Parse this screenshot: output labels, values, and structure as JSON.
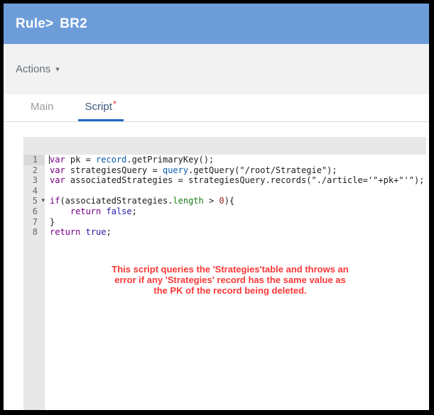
{
  "header": {
    "breadcrumb": "Rule>",
    "title": "BR2"
  },
  "actions": {
    "label": "Actions",
    "caret_icon": "caret-down",
    "caret_glyph": "▾"
  },
  "tabs": [
    {
      "label": "Main",
      "active": false
    },
    {
      "label": "Script",
      "dirty": "*",
      "active": true
    }
  ],
  "editor": {
    "lines": [
      {
        "no": "1",
        "active": true,
        "cursor": true,
        "tokens": [
          [
            "kw",
            "var"
          ],
          [
            "pl",
            " pk = "
          ],
          [
            "obj",
            "record"
          ],
          [
            "pl",
            ".getPrimaryKey();"
          ]
        ]
      },
      {
        "no": "2",
        "tokens": [
          [
            "kw",
            "var"
          ],
          [
            "pl",
            " strategiesQuery = "
          ],
          [
            "obj",
            "query"
          ],
          [
            "pl",
            ".getQuery(\"/root/Strategie\");"
          ]
        ]
      },
      {
        "no": "3",
        "tokens": [
          [
            "kw",
            "var"
          ],
          [
            "pl",
            " associatedStrategies = strategiesQuery.records(\"./article='\"+pk+\"'\");"
          ]
        ]
      },
      {
        "no": "4",
        "tokens": []
      },
      {
        "no": "5",
        "fold": "▾",
        "tokens": [
          [
            "kw",
            "if"
          ],
          [
            "pl",
            "(associatedStrategies."
          ],
          [
            "prop",
            "length"
          ],
          [
            "pl",
            " > "
          ],
          [
            "num",
            "0"
          ],
          [
            "pl",
            "){"
          ]
        ]
      },
      {
        "no": "6",
        "tokens": [
          [
            "pl",
            "    "
          ],
          [
            "kw",
            "return"
          ],
          [
            "pl",
            " "
          ],
          [
            "atom",
            "false"
          ],
          [
            "pl",
            ";"
          ]
        ]
      },
      {
        "no": "7",
        "tokens": [
          [
            "pl",
            "}"
          ]
        ]
      },
      {
        "no": "8",
        "tokens": [
          [
            "kw",
            "return"
          ],
          [
            "pl",
            " "
          ],
          [
            "atom",
            "true"
          ],
          [
            "pl",
            ";"
          ]
        ]
      }
    ],
    "annotation_lines": [
      "This script queries the 'Strategies'table and throws an",
      "error if any 'Strategies' record has the same value as",
      "the PK of the record being deleted."
    ]
  },
  "palette": {
    "header_blue": "#6d9dd9",
    "tab_underline_blue": "#2269c3",
    "keyword": "#770088",
    "api_object": "#0b5bb0",
    "boolean": "#2217a9",
    "property": "#147a14",
    "number": "#9b2222",
    "code_text": "#1c1c1c",
    "annotation_red": "#fa3737"
  }
}
